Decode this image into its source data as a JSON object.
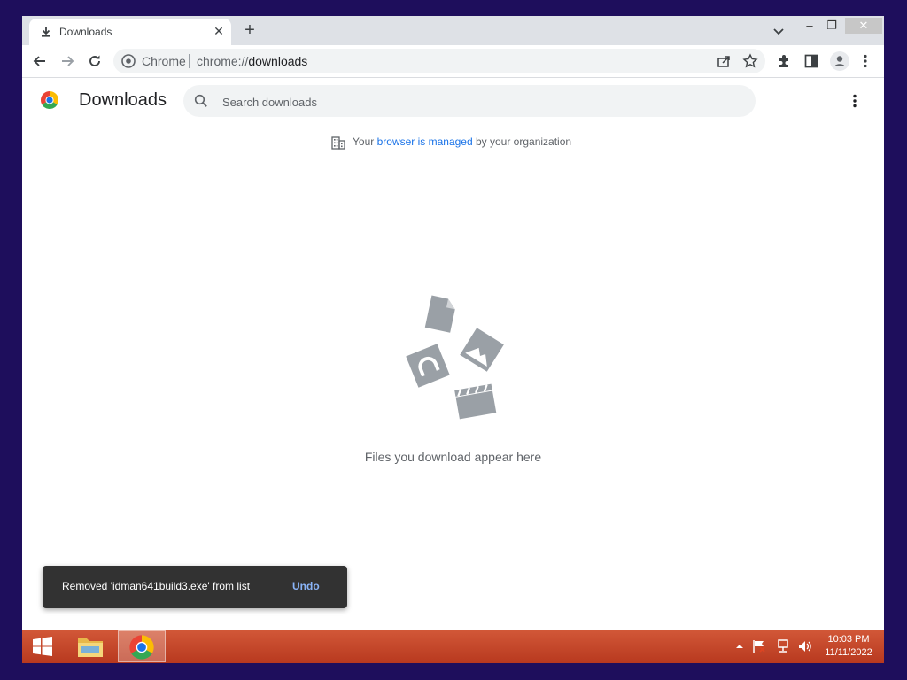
{
  "browser": {
    "tab": {
      "title": "Downloads",
      "icon": "download-icon"
    },
    "new_tab_label": "+",
    "window_controls": {
      "minimize": "–",
      "maximize": "❐",
      "close": "✕"
    },
    "omnibox": {
      "site_chip": "Chrome",
      "url_prefix": "chrome://",
      "url_host": "downloads"
    }
  },
  "page": {
    "title": "Downloads",
    "search_placeholder": "Search downloads",
    "managed": {
      "prefix": "Your",
      "link": "browser is managed",
      "suffix": "by your organization"
    },
    "empty_message": "Files you download appear here"
  },
  "toast": {
    "message": "Removed 'idman641build3.exe' from list",
    "action": "Undo"
  },
  "taskbar": {
    "time": "10:03 PM",
    "date": "11/11/2022"
  },
  "colors": {
    "desktop": "#1e0e5c",
    "taskbar": "#c8462a",
    "link": "#1a73e8",
    "toast_bg": "#323232",
    "toast_action": "#8ab4f8",
    "illustration": "#9aa0a6"
  }
}
